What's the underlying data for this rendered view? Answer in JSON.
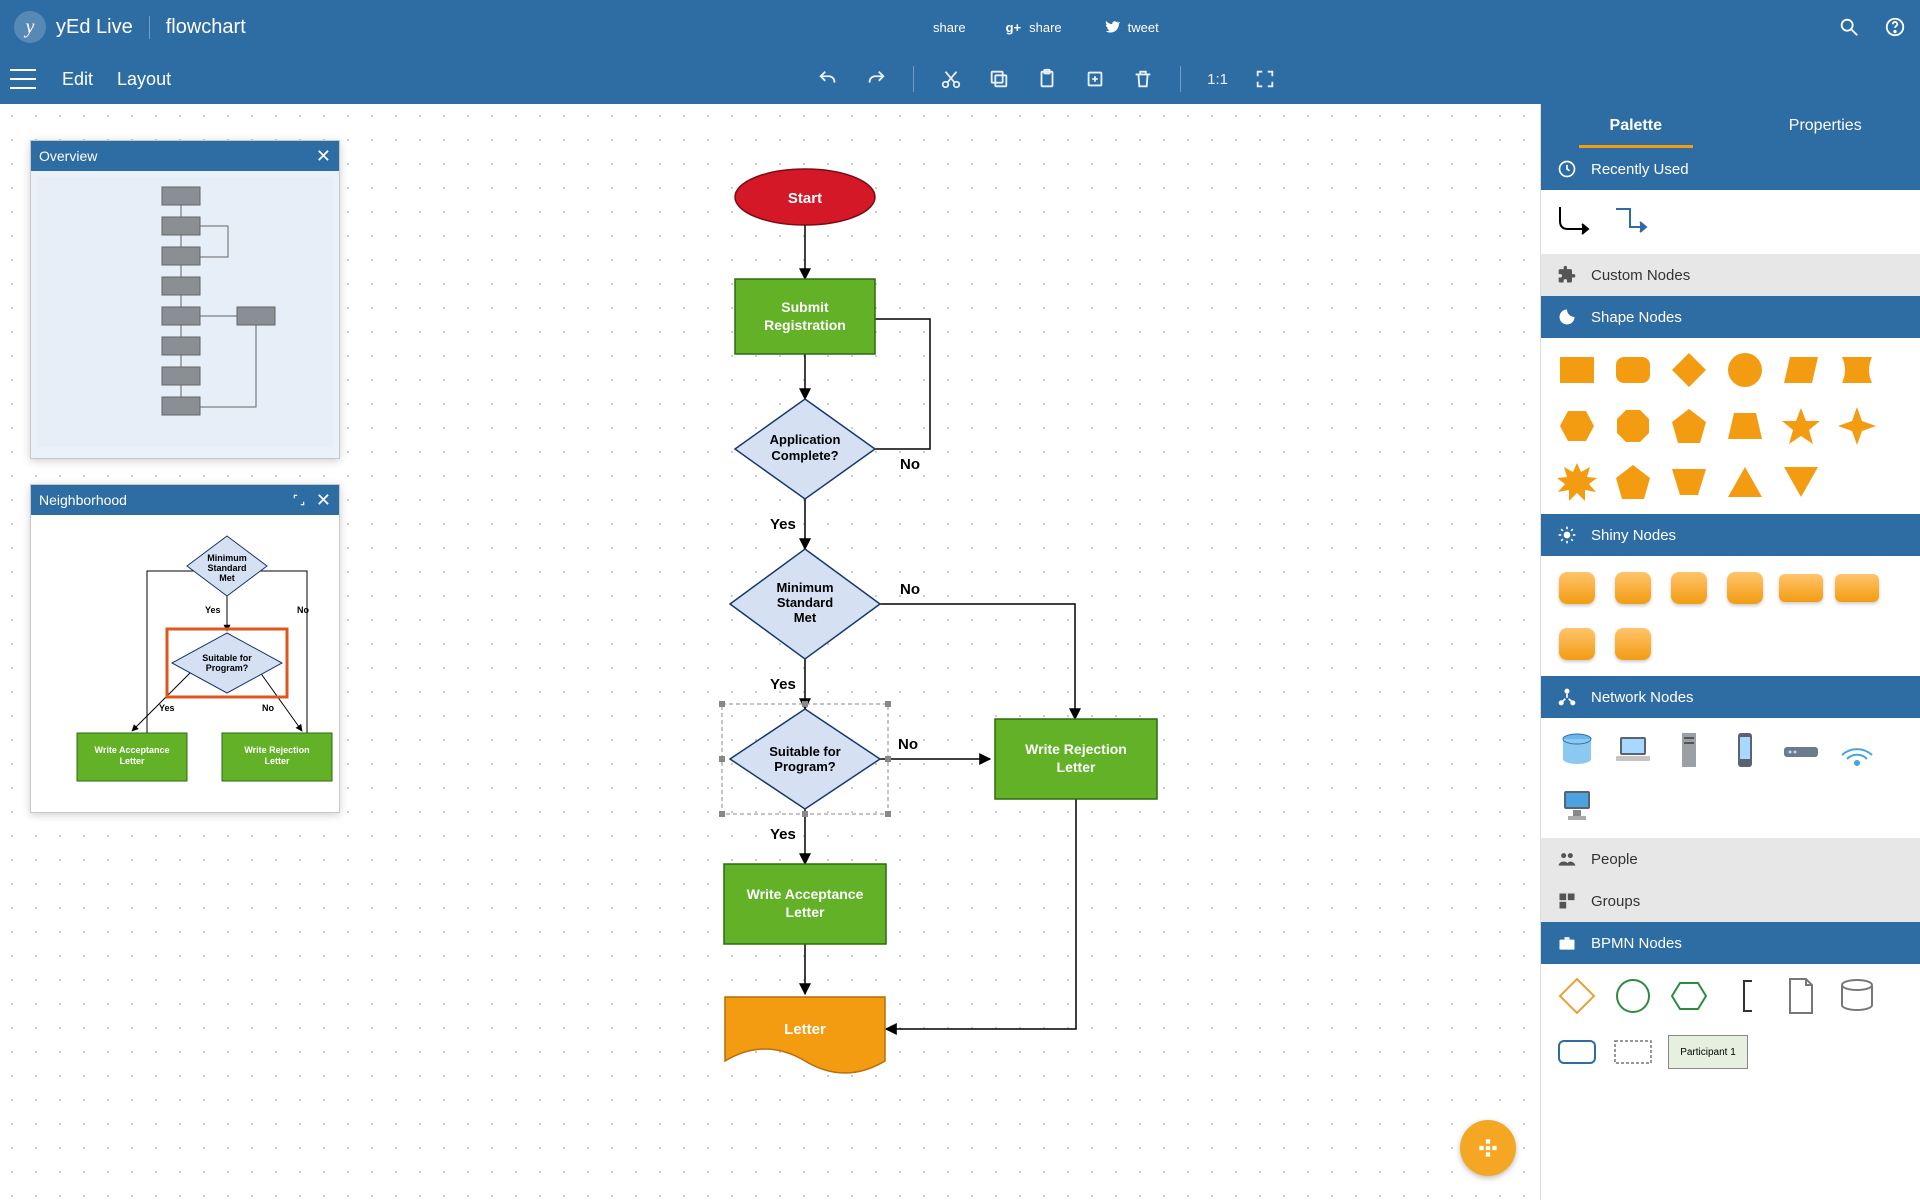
{
  "header": {
    "brand": "yEd Live",
    "document": "flowchart",
    "share_fb": "share",
    "share_gp": "share",
    "share_tw": "tweet"
  },
  "menu": {
    "edit": "Edit",
    "layout": "Layout",
    "ratio": "1:1"
  },
  "panels": {
    "overview_title": "Overview",
    "neighborhood_title": "Neighborhood"
  },
  "sidebar": {
    "tab_palette": "Palette",
    "tab_properties": "Properties",
    "sections": {
      "recent": "Recently Used",
      "custom": "Custom Nodes",
      "shape": "Shape Nodes",
      "shiny": "Shiny Nodes",
      "network": "Network Nodes",
      "people": "People",
      "groups": "Groups",
      "bpmn": "BPMN Nodes"
    },
    "bpmn_participant": "Participant 1"
  },
  "flow": {
    "start": "Start",
    "submit": "Submit Registration",
    "complete": "Application Complete?",
    "minimum": "Minimum Standard Met",
    "suitable": "Suitable for Program?",
    "accept": "Write Acceptance Letter",
    "reject": "Write Rejection Letter",
    "letter": "Letter"
  },
  "labels": {
    "yes": "Yes",
    "no": "No"
  },
  "neighborhood": {
    "minimum": "Minimum Standard Met",
    "suitable": "Suitable for Program?",
    "accept": "Write Acceptance Letter",
    "reject": "Write Rejection Letter",
    "yes": "Yes",
    "no": "No"
  }
}
